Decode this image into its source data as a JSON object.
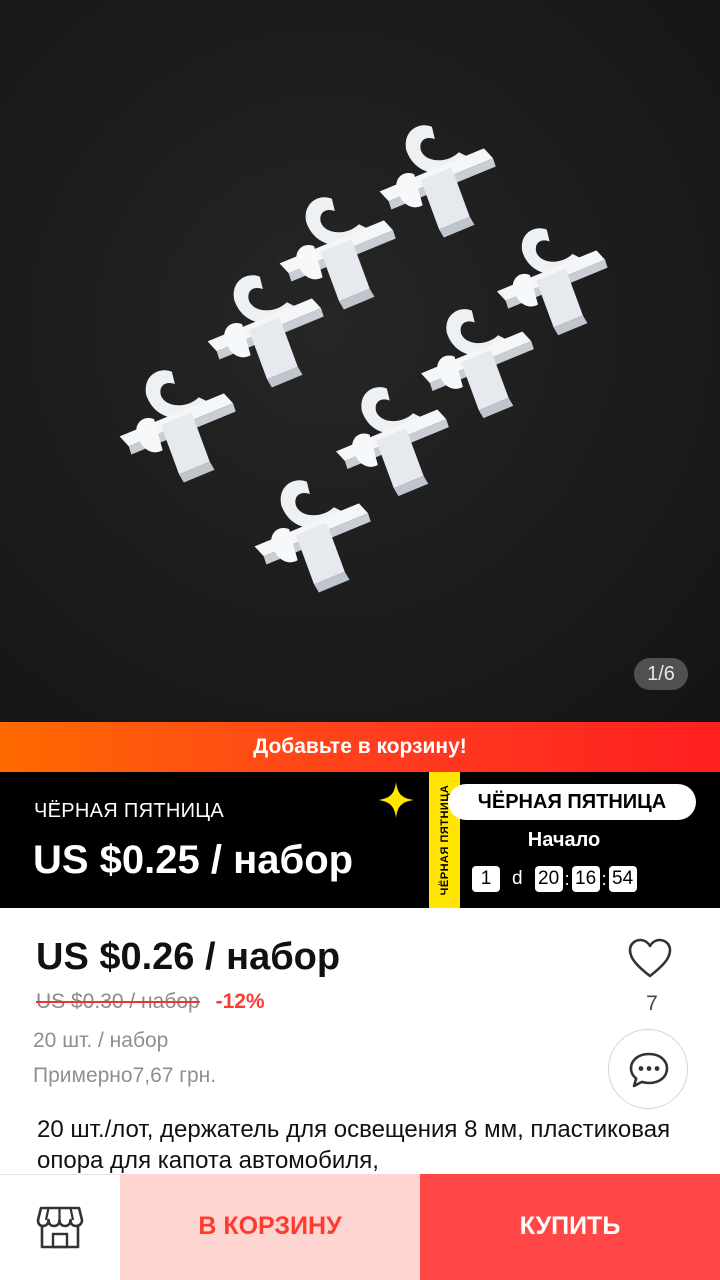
{
  "gallery": {
    "counter": "1/6",
    "image_alt_icon": "product-photo-plastic-clips"
  },
  "promo_strip": {
    "text": "Добавьте в корзину!"
  },
  "black_friday": {
    "label": "ЧЁРНАЯ ПЯТНИЦА",
    "price": "US $0.25 / набор",
    "tape_text": "ЧЁРНАЯ ПЯТНИЦА",
    "pill": "ЧЁРНАЯ ПЯТНИЦА",
    "start_label": "Начало",
    "countdown": {
      "days": "1",
      "days_unit": "d",
      "hours": "20",
      "minutes": "16",
      "seconds": "54"
    },
    "colors": {
      "tape": "#ffe500",
      "background": "#000000"
    }
  },
  "product": {
    "price": "US $0.26 / набор",
    "old_price": "US $0.30 / набор",
    "discount": "-12%",
    "pack": "20 шт. / набор",
    "approx": "Примерно7,67 грн.",
    "title": "20 шт./лот, держатель для освещения 8 мм, пластиковая опора для капота автомобиля,",
    "wishlist_count": "7"
  },
  "bottom_bar": {
    "store_icon": "store-icon",
    "cart_label": "В КОРЗИНУ",
    "buy_label": "КУПИТЬ",
    "colors": {
      "cart_bg": "#ffd5d2",
      "cart_text": "#ff3b30",
      "buy_bg": "#ff4747"
    }
  }
}
